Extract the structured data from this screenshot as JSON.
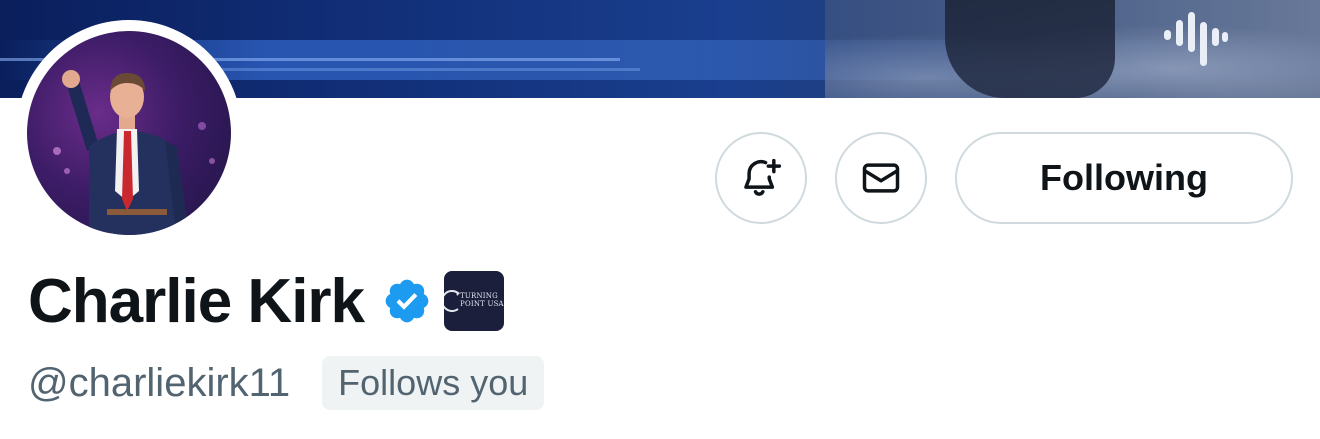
{
  "profile": {
    "name": "Charlie Kirk",
    "handle": "@charliekirk11",
    "follows_you_label": "Follows you",
    "affiliate_badge_text": "TURNING POINT USA"
  },
  "actions": {
    "notify_icon": "bell-plus-icon",
    "message_icon": "envelope-icon",
    "following_label": "Following"
  },
  "colors": {
    "verified_blue": "#1d9bf0",
    "text_primary": "#0f1419",
    "text_secondary": "#536471",
    "button_border": "#cfd9de"
  }
}
